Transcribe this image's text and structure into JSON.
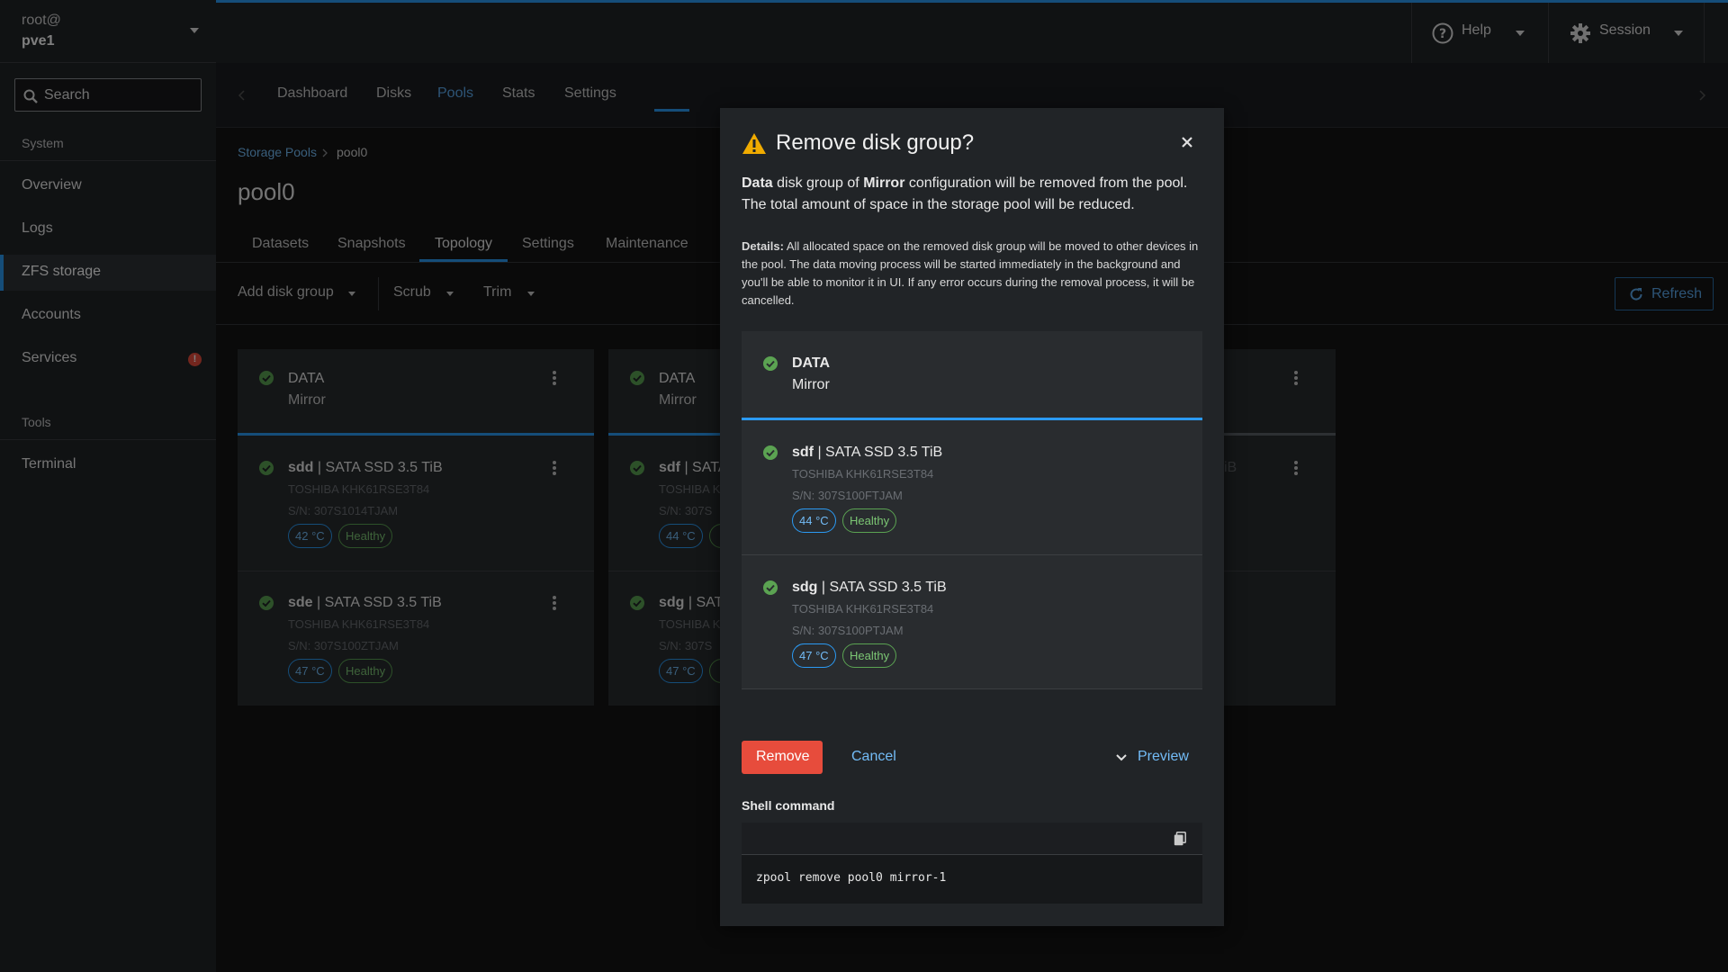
{
  "host": {
    "user": "root@",
    "name": "pve1"
  },
  "search": {
    "label": "Search"
  },
  "sidebar": {
    "system_label": "System",
    "tools_label": "Tools",
    "items": [
      {
        "label": "Overview"
      },
      {
        "label": "Logs"
      },
      {
        "label": "ZFS storage"
      },
      {
        "label": "Accounts"
      },
      {
        "label": "Services",
        "alert": "!"
      },
      {
        "label": "Terminal"
      }
    ]
  },
  "header": {
    "help_label": "Help",
    "session_label": "Session"
  },
  "tabs": [
    "Dashboard",
    "Disks",
    "Pools",
    "Stats",
    "Settings"
  ],
  "breadcrumb": {
    "parent": "Storage Pools",
    "current": "pool0"
  },
  "pool": {
    "title": "pool0",
    "subtabs": [
      "Datasets",
      "Snapshots",
      "Topology",
      "Settings",
      "Maintenance"
    ]
  },
  "actions": {
    "add_disk_group": "Add disk group",
    "scrub": "Scrub",
    "trim": "Trim",
    "refresh": "Refresh"
  },
  "cards": [
    {
      "type": "DATA",
      "config": "Mirror",
      "disks": [
        {
          "dev": "sdd",
          "desc": "| SATA SSD 3.5 TiB",
          "model": "TOSHIBA KHK61RSE3T84",
          "serial": "S/N: 307S1014TJAM",
          "temp": "42 °C",
          "status": "Healthy"
        },
        {
          "dev": "sde",
          "desc": "| SATA SSD 3.5 TiB",
          "model": "TOSHIBA KHK61RSE3T84",
          "serial": "S/N: 307S100ZTJAM",
          "temp": "47 °C",
          "status": "Healthy"
        }
      ]
    },
    {
      "type": "DATA",
      "config": "Mirror",
      "disks": [
        {
          "dev": "sdf",
          "desc": "| SATA",
          "model": "TOSHIBA K",
          "serial": "S/N: 307S",
          "temp": "44 °C"
        },
        {
          "dev": "sdg",
          "desc": "| SATA",
          "model": "TOSHIBA K",
          "serial": "S/N: 307S",
          "temp": "47 °C"
        }
      ]
    },
    {
      "partial_desc": "iB"
    }
  ],
  "modal": {
    "title": "Remove disk group?",
    "body_bold1": "Data",
    "body_text1": " disk group of ",
    "body_bold2": "Mirror",
    "body_text2": " configuration will be removed from the pool. The total amount of space in the storage pool will be reduced.",
    "details_label": "Details:",
    "details_text": " All allocated space on the removed disk group will be moved to other devices in the pool. The data moving process will be started immediately in the background and you'll be able to monitor it in UI. If any error occurs during the removal process, it will be cancelled.",
    "group": {
      "type": "DATA",
      "config": "Mirror"
    },
    "disks": [
      {
        "dev": "sdf",
        "desc": "| SATA SSD 3.5 TiB",
        "model": "TOSHIBA KHK61RSE3T84",
        "serial": "S/N: 307S100FTJAM",
        "temp": "44 °C",
        "status": "Healthy"
      },
      {
        "dev": "sdg",
        "desc": "| SATA SSD 3.5 TiB",
        "model": "TOSHIBA KHK61RSE3T84",
        "serial": "S/N: 307S100PTJAM",
        "temp": "47 °C",
        "status": "Healthy"
      }
    ],
    "remove_label": "Remove",
    "cancel_label": "Cancel",
    "preview_label": "Preview",
    "shell_label": "Shell command",
    "command": "zpool remove pool0 mirror-1"
  },
  "colors": {
    "accent": "#2b9af3",
    "danger": "#e74c3c",
    "success": "#5ba352",
    "warning": "#f0ab00"
  }
}
